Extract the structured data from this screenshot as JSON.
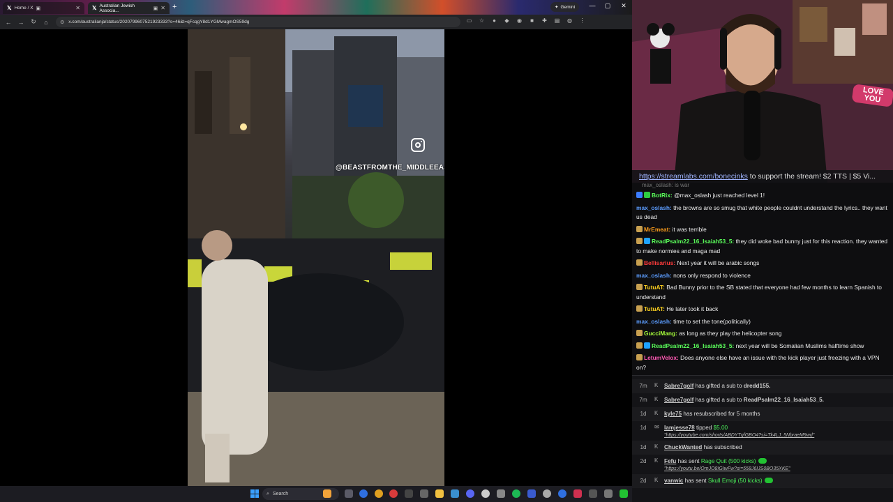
{
  "browser": {
    "tabs": [
      {
        "label": "Home / X",
        "active": false
      },
      {
        "label": "Australian Jewish Associa...",
        "active": true
      }
    ],
    "new_tab": "+",
    "gemini_label": "Gemini",
    "url": "x.com/australianja/status/2020799607521923333?s=46&t=qFcqgY8d1YGMwagmOS59dg",
    "video_handle": "@BEASTFROMTHE_MIDDLEEAST"
  },
  "taskbar": {
    "search_placeholder": "Search"
  },
  "stream": {
    "webcam_sign": "LOVE YOU",
    "ticker_link": "https://streamlabs.com/bonecinks",
    "ticker_text": " to support the stream! $2 TTS | $5 Vi..."
  },
  "chat": {
    "cut_off": "max_oslash: is war",
    "messages": [
      {
        "user": "BotRix",
        "text": "@max_oslash just reached level 1!",
        "color": "#5bff5b",
        "badges": [
          "#3b7cff",
          "#2ecc40"
        ]
      },
      {
        "user": "max_oslash",
        "text": "the browns are so smug that white people couldnt understand the lyrics.. they want us dead",
        "color": "#5c9dff",
        "badges": []
      },
      {
        "user": "MrEmeat",
        "text": "it was terrible",
        "color": "#ff9f1c",
        "badges": [
          "#c8a050"
        ]
      },
      {
        "user": "ReadPsalm22_16_Isaiah53_5",
        "text": "they did woke bad bunny just for this reaction. they wanted to make normies and maga mad",
        "color": "#5bff5b",
        "badges": [
          "#c8a050",
          "#1fa3ff"
        ]
      },
      {
        "user": "Bellisarius",
        "text": "Next year it will be arabic songs",
        "color": "#ff3b3b",
        "badges": [
          "#c8a050"
        ]
      },
      {
        "user": "max_oslash",
        "text": "nons only respond to violence",
        "color": "#5c9dff",
        "badges": []
      },
      {
        "user": "TutuAT",
        "text": "Bad Bunny prior to the SB stated that everyone had few months to learn Spanish to understand",
        "color": "#ffd21f",
        "badges": [
          "#c8a050"
        ]
      },
      {
        "user": "TutuAT",
        "text": "He later took it back",
        "color": "#ffd21f",
        "badges": [
          "#c8a050"
        ]
      },
      {
        "user": "max_oslash",
        "text": "time to set the tone(politically)",
        "color": "#5c9dff",
        "badges": []
      },
      {
        "user": "GucciMang",
        "text": "as long as they play the helicopter song",
        "color": "#a8ff3b",
        "badges": [
          "#c8a050"
        ]
      },
      {
        "user": "ReadPsalm22_16_Isaiah53_5",
        "text": "next year will be Somalian Muslims halftime show",
        "color": "#5bff5b",
        "badges": [
          "#c8a050",
          "#1fa3ff"
        ]
      },
      {
        "user": "LetumVelox",
        "text": "Does anyone else have an issue with the kick player just freezing with a VPN on?",
        "color": "#ff5ab4",
        "badges": [
          "#c8a050"
        ]
      }
    ]
  },
  "events": [
    {
      "time": "7m",
      "icon": "kick",
      "user": "Sabre7golf",
      "text": " has gifted a sub to ",
      "target": "dredd155.",
      "sub": ""
    },
    {
      "time": "7m",
      "icon": "kick",
      "user": "Sabre7golf",
      "text": " has gifted a sub to ",
      "target": "ReadPsalm22_16_Isaiah53_5.",
      "sub": ""
    },
    {
      "time": "1d",
      "icon": "kick",
      "user": "kyle75",
      "text": " has resubscribed for 5 months",
      "target": "",
      "sub": ""
    },
    {
      "time": "1d",
      "icon": "tip",
      "user": "Iamjesse78",
      "text": " tipped ",
      "target": "$5.00",
      "sub": "\"https://youtube.com/shorts/ABDYTqfGBO4?si=Tk4LJ_5NbraeM9wd\""
    },
    {
      "time": "1d",
      "icon": "kick",
      "user": "ChuckWanted",
      "text": " has subscribed",
      "target": "",
      "sub": ""
    },
    {
      "time": "2d",
      "icon": "kick",
      "user": "Fefu",
      "text": " has sent ",
      "target": "Rage Quit (500 kicks)",
      "sub": "\"https://youtu.be/OmJO8IGIwFw?si=558J6IJS0BO35XKE\""
    },
    {
      "time": "2d",
      "icon": "kick",
      "user": "vanwic",
      "text": " has sent ",
      "target": "Skull Emoji (50 kicks)",
      "sub": ""
    }
  ]
}
